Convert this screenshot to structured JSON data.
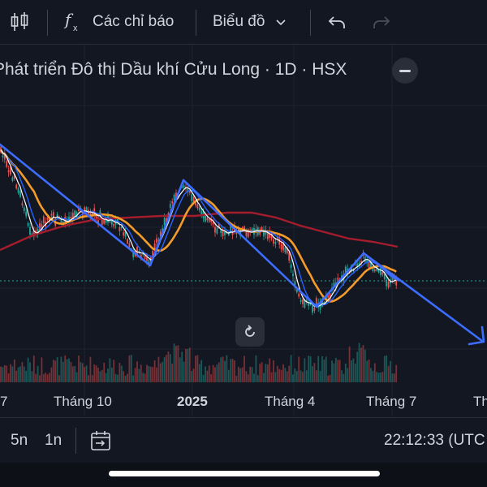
{
  "toolbar": {
    "indicators_label": "Các chỉ báo",
    "chart_type_label": "Biểu đồ"
  },
  "chart": {
    "title": "Phát triển Đô thị Dầu khí Cửu Long · 1D · HSX",
    "x_axis_labels": [
      "7",
      "Tháng 10",
      "2025",
      "Tháng 4",
      "Tháng 7",
      "Th"
    ]
  },
  "bottombar": {
    "range_5d": "5n",
    "range_1d": "1n",
    "clock": "22:12:33 (UTC"
  },
  "colors": {
    "background": "#131722",
    "trendline": "#3d6dff",
    "ma_orange": "#f39c2b",
    "ma_red": "#a51d2d",
    "ma_blue": "#2962ff",
    "ma_white": "#ffffff",
    "candle_up": "#26a69a",
    "candle_down": "#ef5350",
    "price_line": "#26a69a"
  },
  "icons": [
    "candles-icon",
    "fx-icon",
    "chevron-down-icon",
    "undo-icon",
    "redo-icon",
    "minus-icon",
    "reset-icon",
    "go-to-date-icon"
  ]
}
